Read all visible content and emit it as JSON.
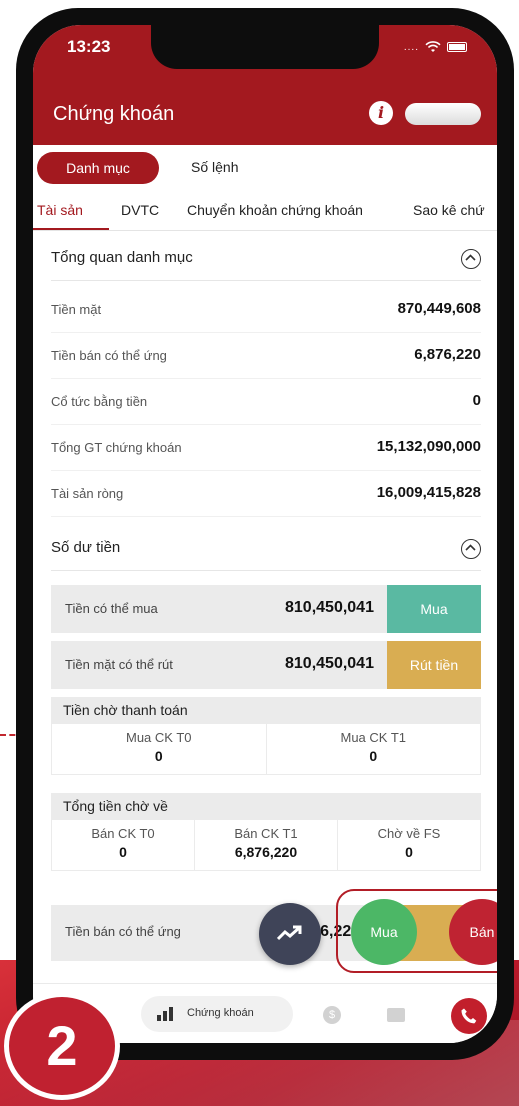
{
  "status_bar": {
    "time": "13:23",
    "dots": "...."
  },
  "header": {
    "title": "Chứng khoán"
  },
  "segments": {
    "active": "Danh mục",
    "other": "Số lệnh"
  },
  "tabs": [
    "Tài sản",
    "DVTC",
    "Chuyển khoản chứng khoán",
    "Sao kê chứ"
  ],
  "overview": {
    "title": "Tổng quan danh mục",
    "rows": [
      {
        "label": "Tiền mặt",
        "value": "870,449,608"
      },
      {
        "label": "Tiền bán có thể ứng",
        "value": "6,876,220"
      },
      {
        "label": "Cổ tức bằng tiền",
        "value": "0"
      },
      {
        "label": "Tổng GT chứng khoán",
        "value": "15,132,090,000"
      },
      {
        "label": "Tài sản ròng",
        "value": "16,009,415,828"
      }
    ]
  },
  "balance": {
    "title": "Số dư tiền",
    "buy_power": {
      "label": "Tiền có thể mua",
      "value": "810,450,041",
      "button": "Mua"
    },
    "withdraw": {
      "label": "Tiền mặt có thể rút",
      "value": "810,450,041",
      "button": "Rút tiền"
    },
    "pending_payment": {
      "title": "Tiền chờ thanh toán",
      "cells": [
        {
          "label": "Mua CK T0",
          "value": "0"
        },
        {
          "label": "Mua CK T1",
          "value": "0"
        }
      ]
    },
    "pending_receive": {
      "title": "Tổng tiền chờ về",
      "cells": [
        {
          "label": "Bán CK T0",
          "value": "0"
        },
        {
          "label": "Bán CK T1",
          "value": "6,876,220"
        },
        {
          "label": "Chờ về FS",
          "value": "0"
        }
      ]
    },
    "advance": {
      "label": "Tiền bán có thể ứng",
      "value_partial": "6,876,220",
      "button_line1": "Ứ",
      "button_line2": "ti"
    }
  },
  "fab": {
    "buy": "Mua",
    "sell": "Bán"
  },
  "bottom_nav": {
    "active_label": "Chứng khoán",
    "coin_symbol": "$"
  },
  "badge": "2",
  "colors": {
    "brand": "#a3191f",
    "buy": "#5ab9a2",
    "withdraw": "#d9ad52",
    "fab_buy": "#4cb766",
    "fab_sell": "#bf2332"
  }
}
